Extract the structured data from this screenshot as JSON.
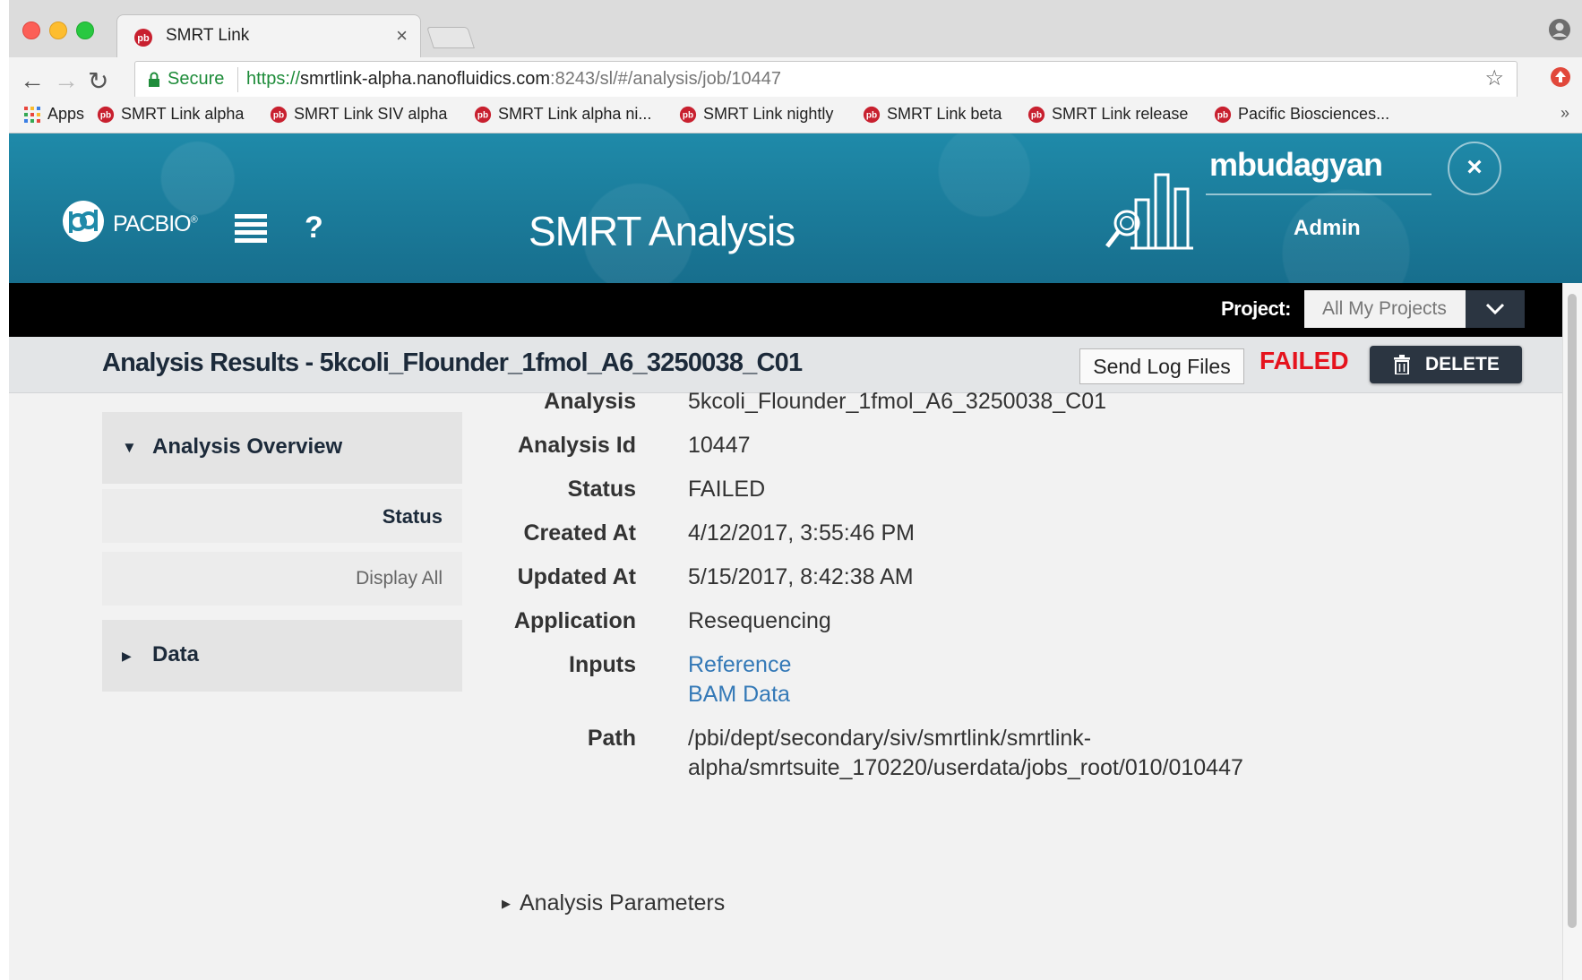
{
  "browser": {
    "tab_title": "SMRT Link",
    "url_scheme": "https://",
    "url_host": "smrtlink-alpha.nanofluidics.com",
    "url_rest": ":8243/sl/#/analysis/job/10447",
    "secure_label": "Secure",
    "tab_close_glyph": "×",
    "star_glyph": "☆",
    "back_glyph": "←",
    "forward_glyph": "→",
    "reload_glyph": "↻",
    "more_glyph": "»"
  },
  "bookmarks": [
    {
      "label": "Apps",
      "icon": "apps-grid-icon"
    },
    {
      "label": "SMRT Link alpha",
      "icon": "pacbio-favicon"
    },
    {
      "label": "SMRT Link SIV alpha",
      "icon": "pacbio-favicon"
    },
    {
      "label": "SMRT Link alpha ni...",
      "icon": "pacbio-favicon"
    },
    {
      "label": "SMRT Link nightly",
      "icon": "pacbio-favicon"
    },
    {
      "label": "SMRT Link beta",
      "icon": "pacbio-favicon"
    },
    {
      "label": "SMRT Link release",
      "icon": "pacbio-favicon"
    },
    {
      "label": "Pacific Biosciences...",
      "icon": "pacbio-favicon"
    }
  ],
  "header": {
    "brand": "PACBIO",
    "brand_mark": "®",
    "help_glyph": "?",
    "app_title": "SMRT Analysis",
    "user_name": "mbudagyan",
    "user_role": "Admin",
    "close_glyph": "×"
  },
  "project": {
    "label": "Project:",
    "selected": "All My Projects"
  },
  "results": {
    "title": "Analysis Results - 5kcoli_Flounder_1fmol_A6_3250038_C01",
    "send_log_label": "Send Log Files",
    "status_badge": "FAILED",
    "delete_label": "DELETE",
    "status_color": "#e5131d"
  },
  "sidebar": {
    "overview_label": "Analysis Overview",
    "status_label": "Status",
    "display_all_label": "Display All",
    "data_label": "Data",
    "expanded_glyph": "▼",
    "collapsed_glyph": "▶"
  },
  "details": {
    "analysis_label": "Analysis",
    "analysis_value": "5kcoli_Flounder_1fmol_A6_3250038_C01",
    "id_label": "Analysis Id",
    "id_value": "10447",
    "status_label": "Status",
    "status_value": "FAILED",
    "created_label": "Created At",
    "created_value": "4/12/2017, 3:55:46 PM",
    "updated_label": "Updated At",
    "updated_value": "5/15/2017, 8:42:38 AM",
    "application_label": "Application",
    "application_value": "Resequencing",
    "inputs_label": "Inputs",
    "inputs": [
      "Reference",
      "BAM Data"
    ],
    "path_label": "Path",
    "path_line1": "/pbi/dept/secondary/siv/smrtlink/smrtlink-",
    "path_line2": "alpha/smrtsuite_170220/userdata/jobs_root/010/010447",
    "parameters_label": "Analysis Parameters",
    "parameters_glyph": "▶"
  },
  "colors": {
    "header_teal": "#1f8aa9",
    "dark_navy": "#2b3541",
    "link_blue": "#3479b7",
    "failed_red": "#e5131d"
  }
}
